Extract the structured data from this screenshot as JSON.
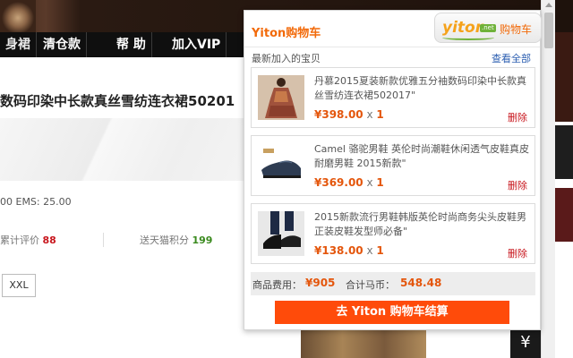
{
  "page": {
    "nav": [
      "身裙",
      "清仓款",
      "帮 助",
      "加入VIP"
    ],
    "product_title": "数码印染中长款真丝雪纺连衣裙50201",
    "shipping": "00 EMS: 25.00",
    "reviews_label": "累计评价",
    "reviews_count": "88",
    "points_label": "送天猫积分",
    "points_value": "199",
    "size_option": "XXL",
    "bottom_icon": "¥"
  },
  "popup": {
    "title": "Yiton购物车",
    "logo_text": "yiton",
    "logo_net": ".net",
    "logo_cart": "购物车",
    "recent_label": "最新加入的宝贝",
    "view_all": "查看全部",
    "items": [
      {
        "name": "丹慕2015夏装新款优雅五分袖数码印染中长款真丝雪纺连衣裙502017\"",
        "price": "¥398.00",
        "x": "x",
        "qty": "1",
        "delete": "删除"
      },
      {
        "name": "Camel 骆驼男鞋 英伦时尚潮鞋休闲透气皮鞋真皮耐磨男鞋 2015新款\"",
        "price": "¥369.00",
        "x": "x",
        "qty": "1",
        "delete": "删除"
      },
      {
        "name": "2015新款流行男鞋韩版英伦时尚商务尖头皮鞋男正装皮鞋发型师必备\"",
        "price": "¥138.00",
        "x": "x",
        "qty": "1",
        "delete": "删除"
      }
    ],
    "summary": {
      "fee_label": "商品费用：",
      "fee_value": "¥905",
      "coins_label": "合计马币：",
      "coins_value": "548.48"
    },
    "checkout_label": "去 Yiton 购物车结算"
  }
}
